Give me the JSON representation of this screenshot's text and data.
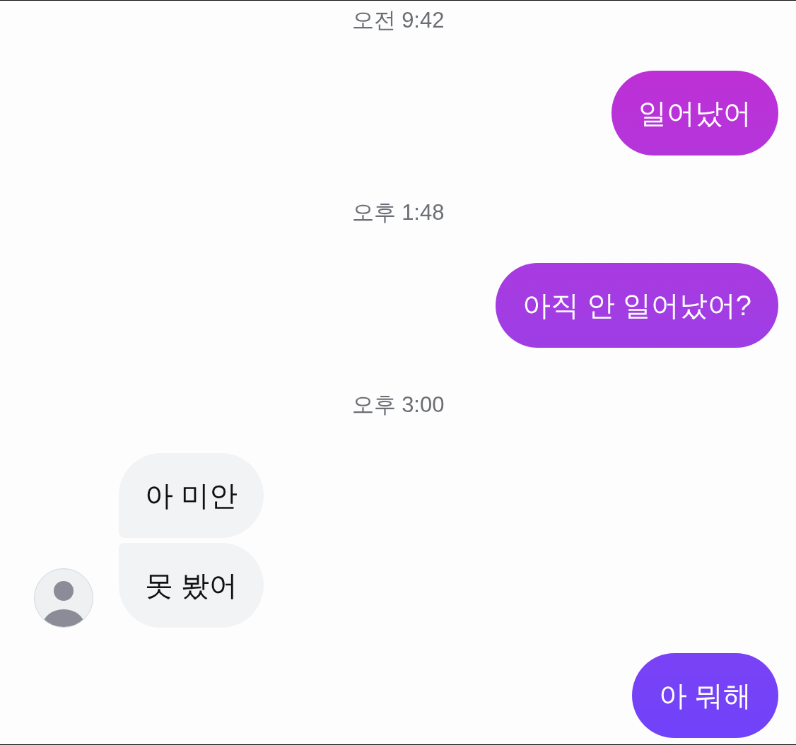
{
  "messages": [
    {
      "kind": "timestamp",
      "text": "오전 9:42"
    },
    {
      "kind": "outgoing",
      "text": "일어났어"
    },
    {
      "kind": "timestamp",
      "text": "오후 1:48"
    },
    {
      "kind": "outgoing",
      "text": "아직 안 일어났어?"
    },
    {
      "kind": "timestamp",
      "text": "오후 3:00"
    },
    {
      "kind": "incoming",
      "bubbles": [
        "아 미안",
        "못 봤어"
      ]
    },
    {
      "kind": "outgoing",
      "text": "아 뭐해"
    }
  ]
}
